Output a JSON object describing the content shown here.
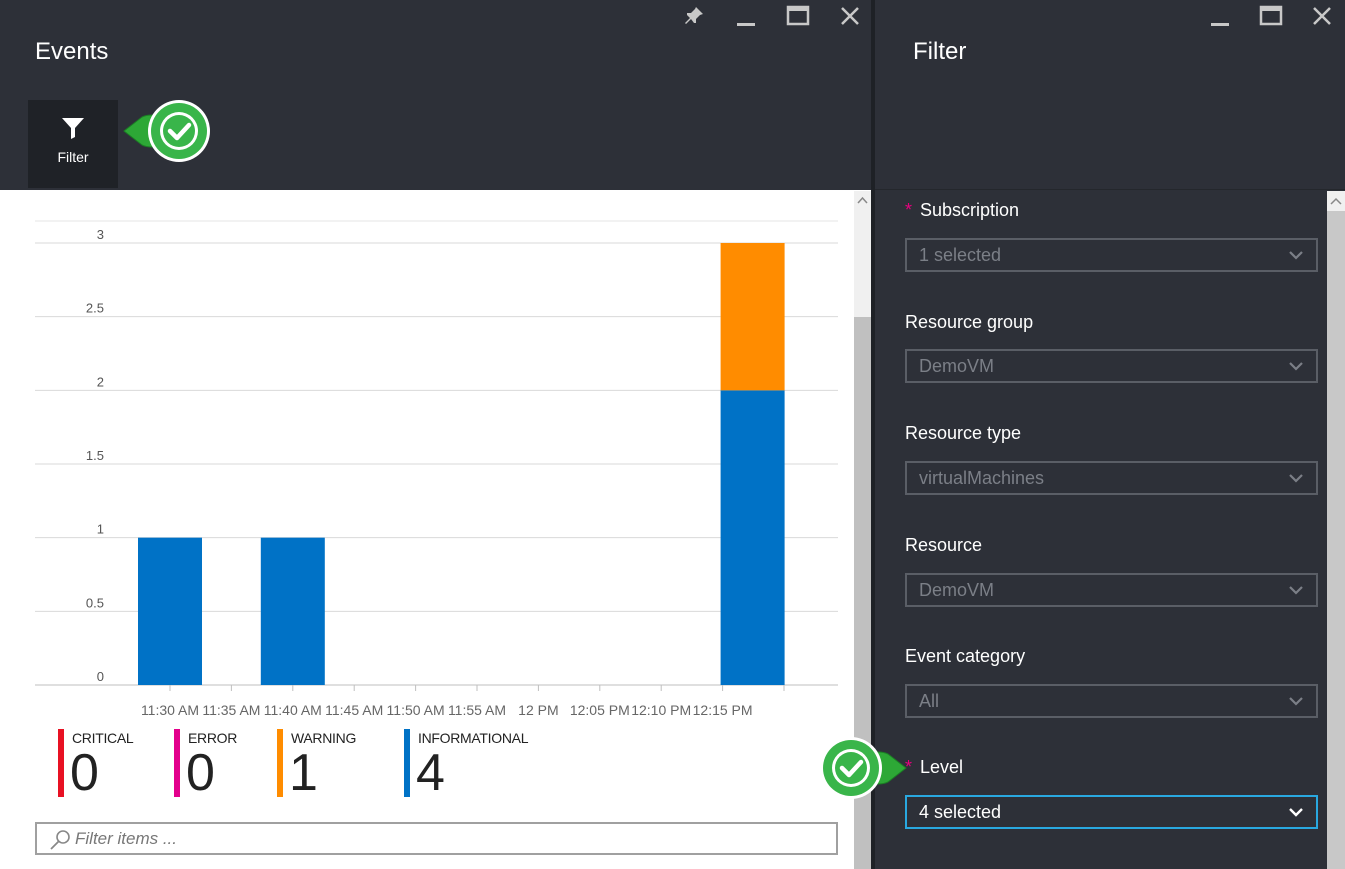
{
  "events_blade": {
    "title": "Events",
    "filter_button_label": "Filter",
    "search_placeholder": "Filter items ...",
    "legend": [
      {
        "name": "CRITICAL",
        "count": "0",
        "color": "#e81123"
      },
      {
        "name": "ERROR",
        "count": "0",
        "color": "#e3008c"
      },
      {
        "name": "WARNING",
        "count": "1",
        "color": "#ff8c00"
      },
      {
        "name": "INFORMATIONAL",
        "count": "4",
        "color": "#0072c6"
      }
    ]
  },
  "chart_data": {
    "type": "bar",
    "stacked": true,
    "categories": [
      "11:30 AM",
      "11:35 AM",
      "11:40 AM",
      "11:45 AM",
      "11:50 AM",
      "11:55 AM",
      "12 PM",
      "12:05 PM",
      "12:10 PM",
      "12:15 PM"
    ],
    "bar_slots": [
      "11:30 AM",
      "11:40 AM",
      "12:15 PM"
    ],
    "series": [
      {
        "values_by_slot": [
          1,
          1,
          2
        ],
        "color": "#0072c6"
      },
      {
        "values_by_slot": [
          0,
          0,
          1
        ],
        "color": "#ff8c00"
      }
    ],
    "y_ticks": [
      "0",
      "0.5",
      "1",
      "1.5",
      "2",
      "2.5",
      "3"
    ],
    "ylim": [
      0,
      3
    ],
    "grid": true
  },
  "filter_blade": {
    "title": "Filter",
    "fields": [
      {
        "label": "Subscription",
        "required": true,
        "value": "1 selected"
      },
      {
        "label": "Resource group",
        "required": false,
        "value": "DemoVM"
      },
      {
        "label": "Resource type",
        "required": false,
        "value": "virtualMachines"
      },
      {
        "label": "Resource",
        "required": false,
        "value": "DemoVM"
      },
      {
        "label": "Event category",
        "required": false,
        "value": "All"
      },
      {
        "label": "Level",
        "required": true,
        "value": "4 selected",
        "active": true
      }
    ],
    "required_marker": "*"
  },
  "icons": [
    "pin-icon",
    "minimize-icon",
    "maximize-icon",
    "close-icon",
    "funnel-icon",
    "search-icon",
    "chevron-down-icon",
    "checkmark-callout-icon"
  ]
}
